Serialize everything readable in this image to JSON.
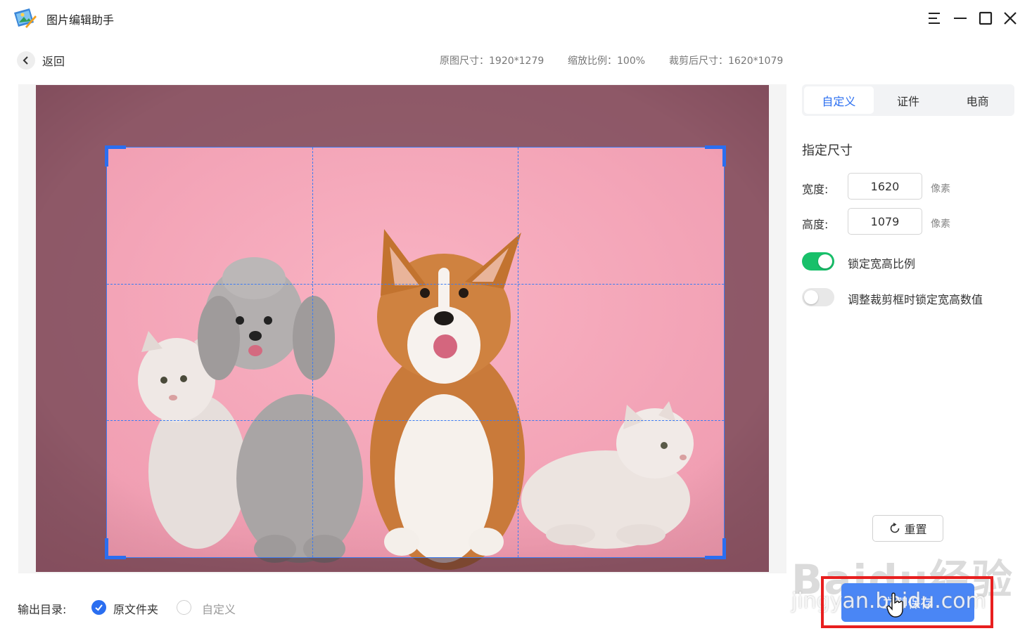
{
  "titlebar": {
    "app_title": "图片编辑助手"
  },
  "header": {
    "back_label": "返回",
    "original_size": "原图尺寸：1920*1279",
    "zoom": "缩放比例：100%",
    "cropped_size": "裁剪后尺寸：1620*1079"
  },
  "panel": {
    "tabs": [
      {
        "label": "自定义",
        "active": true
      },
      {
        "label": "证件",
        "active": false
      },
      {
        "label": "电商",
        "active": false
      }
    ],
    "section_title": "指定尺寸",
    "width_label": "宽度:",
    "width_value": "1620",
    "height_label": "高度:",
    "height_value": "1079",
    "unit": "像素",
    "lock_ratio_label": "锁定宽高比例",
    "lock_ratio_on": true,
    "lock_on_resize_label": "调整裁剪框时锁定宽高数值",
    "lock_on_resize_on": false,
    "reset_label": "重置",
    "save_label": "立即保存"
  },
  "output": {
    "label": "输出目录:",
    "options": [
      {
        "label": "原文件夹",
        "selected": true
      },
      {
        "label": "自定义",
        "selected": false
      }
    ]
  },
  "watermark": {
    "logo": "Baidu经验",
    "url": "jingyan.baidu.com"
  },
  "colors": {
    "accent": "#2a6ef0",
    "toggle_on": "#18c06a",
    "highlight": "#e81f1f",
    "photo_bg": "#f7a8ba"
  }
}
